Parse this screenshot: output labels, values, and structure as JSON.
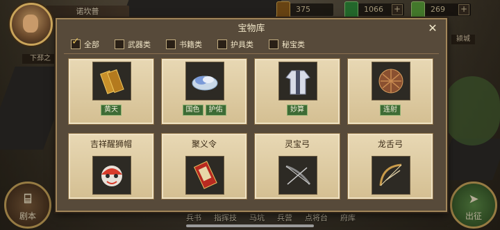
{
  "player": {
    "name": "诺坎普"
  },
  "resources": [
    {
      "icon": "gold-token-icon",
      "value": "375",
      "color": "#8a5a1a"
    },
    {
      "icon": "jade-icon",
      "value": "1066",
      "color": "#2f8a3a"
    },
    {
      "icon": "scroll-icon",
      "value": "269",
      "color": "#5aa03a"
    }
  ],
  "map": {
    "region_label": "下邳之",
    "city_label": "颍城"
  },
  "modal": {
    "title": "宝物库",
    "close": "✕",
    "filters": [
      {
        "label": "全部",
        "checked": true
      },
      {
        "label": "武器类",
        "checked": false
      },
      {
        "label": "书籍类",
        "checked": false
      },
      {
        "label": "护具类",
        "checked": false
      },
      {
        "label": "秘宝类",
        "checked": false
      }
    ],
    "cards": [
      {
        "title": "",
        "icon": "golden-talisman-icon",
        "tags": [
          "黄天"
        ]
      },
      {
        "title": "",
        "icon": "jade-bowl-icon",
        "tags": [
          "国色",
          "护佑"
        ]
      },
      {
        "title": "",
        "icon": "robe-icon",
        "tags": [
          "妙算"
        ]
      },
      {
        "title": "",
        "icon": "sphere-icon",
        "tags": [
          "连射"
        ]
      },
      {
        "title": "吉祥醒狮帽",
        "icon": "lion-hat-icon",
        "tags": []
      },
      {
        "title": "聚义令",
        "icon": "banner-token-icon",
        "tags": []
      },
      {
        "title": "灵宝弓",
        "icon": "bow-icon",
        "tags": []
      },
      {
        "title": "龙舌弓",
        "icon": "longbow-icon",
        "tags": []
      }
    ]
  },
  "bottom": {
    "left_button": {
      "icon": "script-icon",
      "label": "剧本"
    },
    "right_button": {
      "icon": "march-icon",
      "label": "出征"
    },
    "menu": [
      "兵书",
      "指挥技",
      "马坑",
      "兵营",
      "点将台",
      "府库"
    ]
  }
}
